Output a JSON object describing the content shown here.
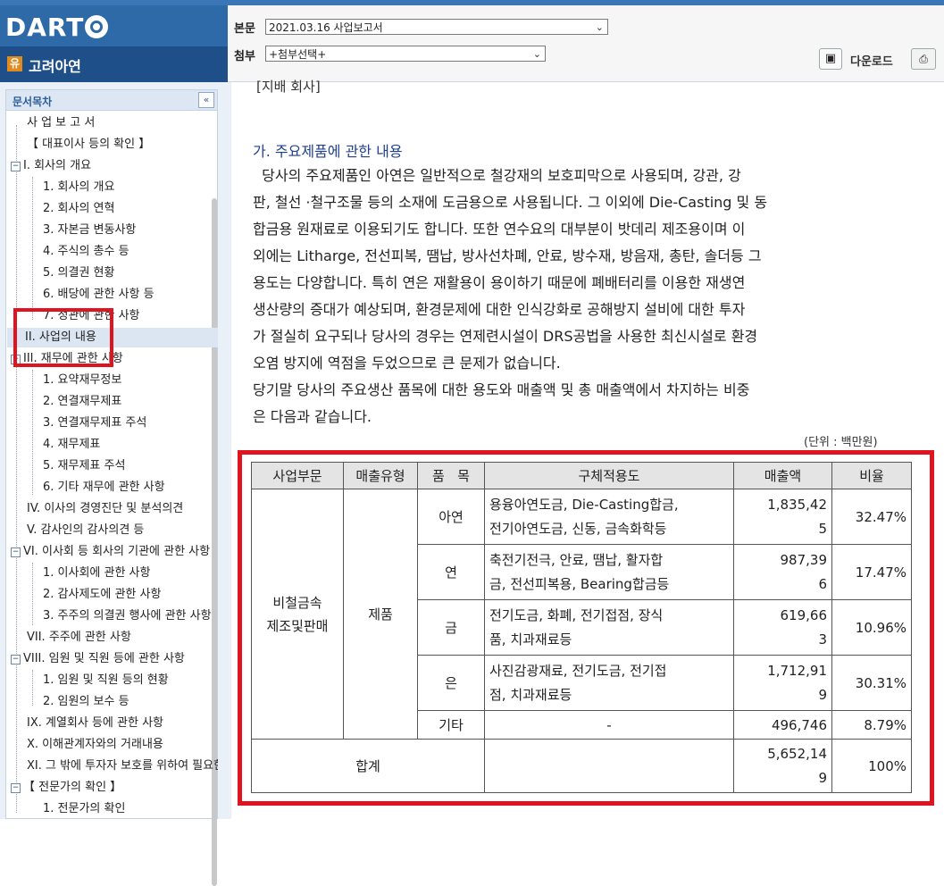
{
  "header": {
    "logo": "DART",
    "company_badge": "유",
    "company_name": "고려아연",
    "main_label": "본문",
    "main_select": "2021.03.16   사업보고서",
    "attach_label": "첨부",
    "attach_select": "+첨부선택+",
    "download_label": "다운로드"
  },
  "sidebar": {
    "title": "문서목차",
    "collapse": "«",
    "items": [
      {
        "label": "사 업 보 고 서"
      },
      {
        "label": "【 대표이사 등의 확인 】"
      },
      {
        "label": "I. 회사의 개요"
      },
      {
        "label": "1. 회사의 개요"
      },
      {
        "label": "2. 회사의 연혁"
      },
      {
        "label": "3. 자본금 변동사항"
      },
      {
        "label": "4. 주식의 총수 등"
      },
      {
        "label": "5. 의결권 현황"
      },
      {
        "label": "6. 배당에 관한 사항 등"
      },
      {
        "label": "7. 정관에 관한 사항"
      },
      {
        "label": "II. 사업의 내용"
      },
      {
        "label": "III. 재무에 관한 사항"
      },
      {
        "label": "1. 요약재무정보"
      },
      {
        "label": "2. 연결재무제표"
      },
      {
        "label": "3. 연결재무제표 주석"
      },
      {
        "label": "4. 재무제표"
      },
      {
        "label": "5. 재무제표 주석"
      },
      {
        "label": "6. 기타 재무에 관한 사항"
      },
      {
        "label": "IV. 이사의 경영진단 및 분석의견"
      },
      {
        "label": "V. 감사인의 감사의견 등"
      },
      {
        "label": "VI. 이사회 등 회사의 기관에 관한 사항"
      },
      {
        "label": "1. 이사회에 관한 사항"
      },
      {
        "label": "2. 감사제도에 관한 사항"
      },
      {
        "label": "3. 주주의 의결권 행사에 관한 사항"
      },
      {
        "label": "VII. 주주에 관한 사항"
      },
      {
        "label": "VIII. 임원 및 직원 등에 관한 사항"
      },
      {
        "label": "1. 임원 및 직원 등의 현황"
      },
      {
        "label": "2. 임원의 보수 등"
      },
      {
        "label": "IX. 계열회사 등에 관한 사항"
      },
      {
        "label": "X. 이해관계자와의 거래내용"
      },
      {
        "label": "XI. 그 밖에 투자자 보호를 위하여 필요한 사항"
      },
      {
        "label": "【 전문가의 확인 】"
      },
      {
        "label": "1. 전문가의 확인"
      }
    ]
  },
  "content": {
    "section_top": "[지배 회사]",
    "heading": "가. 주요제품에 관한 내용",
    "para1": [
      "  당사의 주요제품인 아연은 일반적으로 철강재의 보호피막으로 사용되며, 강관, 강",
      "판, 철선 ·철구조물 등의 소재에 도금용으로 사용됩니다. 그 이외에 Die-Casting 및 동",
      "합금용 원재료로 이용되기도 합니다. 또한 연수요의 대부분이 밧데리 제조용이며 이",
      "외에는 Litharge, 전선피복, 땜납, 방사선차폐, 안료, 방수재, 방음재, 총탄, 솔더등 그",
      "용도는 다양합니다. 특히 연은 재활용이 용이하기 때문에 폐배터리를 이용한 재생연",
      "생산량의 증대가 예상되며, 환경문제에 대한 인식강화로 공해방지 설비에 대한 투자",
      "가 절실히 요구되나 당사의 경우는 연제련시설이 DRS공법을 사용한 최신시설로 환경",
      "오염 방지에 역점을 두었으므로 큰 문제가 없습니다."
    ],
    "para2": [
      "당기말 당사의 주요생산 품목에 대한 용도와 매출액 및 총 매출액에서 차지하는 비중",
      "은 다음과 같습니다."
    ],
    "unit": "(단위 : 백만원)"
  },
  "table": {
    "headers": [
      "사업부문",
      "매출유형",
      "품   목",
      "구체적용도",
      "매출액",
      "비율"
    ],
    "segment": [
      "비철금속",
      "제조및판매"
    ],
    "sales_type": "제품",
    "rows": [
      {
        "item": "아연",
        "usage": [
          "용융아연도금, Die-Casting합금,",
          "전기아연도금, 신동, 금속화학등"
        ],
        "sales": [
          "1,835,42",
          "5"
        ],
        "ratio": "32.47%"
      },
      {
        "item": "연",
        "usage": [
          "축전기전극, 안료, 땜납, 활자합",
          "금, 전선피복용, Bearing합금등"
        ],
        "sales": [
          "987,39",
          "6"
        ],
        "ratio": "17.47%"
      },
      {
        "item": "금",
        "usage": [
          "전기도금, 화폐, 전기접점, 장식",
          "품, 치과재료등"
        ],
        "sales": [
          "619,66",
          "3"
        ],
        "ratio": "10.96%"
      },
      {
        "item": "은",
        "usage": [
          "사진감광재료, 전기도금, 전기접",
          "점, 치과재료등"
        ],
        "sales": [
          "1,712,91",
          "9"
        ],
        "ratio": "30.31%"
      },
      {
        "item": "기타",
        "usage": [
          "-"
        ],
        "sales": [
          "496,746"
        ],
        "ratio": "8.79%"
      }
    ],
    "total_label": "합계",
    "total_sales": [
      "5,652,14",
      "9"
    ],
    "total_ratio": "100%"
  }
}
